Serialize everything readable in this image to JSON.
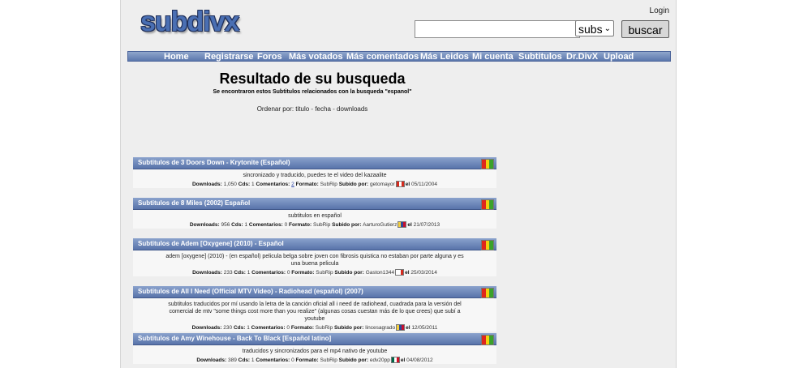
{
  "header": {
    "logo": "subdivx",
    "login": "Login",
    "search": {
      "value": "",
      "placeholder": ""
    },
    "select": {
      "selected": "subs"
    },
    "search_button": "buscar"
  },
  "nav": [
    "Home",
    "Registrarse",
    "Foros",
    "Más votados",
    "Más comentados",
    "Más Leidos",
    "Mi cuenta",
    "Subtitulos",
    "Dr.DivX",
    "Upload"
  ],
  "content": {
    "title": "Resultado de su busqueda",
    "subtitle": "Se encontraron estos Subtitulos relacionados con la busqueda \"espanol\"",
    "order_label": "Ordenar por:",
    "order_titulo": "titulo",
    "order_fecha": "fecha",
    "order_downloads": "downloads",
    "order_sep": "-"
  },
  "meta_labels": {
    "downloads": "Downloads:",
    "cds": "Cds:",
    "comentarios": "Comentarios:",
    "formato": "Formato:",
    "subido_por": "Subido por:",
    "el": "el"
  },
  "results": [
    {
      "title": "Subtitulos de 3 Doors Down - Krytonite (Español)",
      "description": "sincronizado y traducido, puedes te el video del kazaalite",
      "downloads": "1,050",
      "cds": "1",
      "comentarios": "2",
      "formato": "SubRip",
      "user": "getomayor",
      "date": "05/11/2004",
      "flag": [
        "#d52b1e",
        "#ffffff",
        "#d52b1e"
      ]
    },
    {
      "title": "Subtitulos de 8 Miles (2002) Español",
      "description": "subtitulos en español",
      "downloads": "956",
      "cds": "1",
      "comentarios": "0",
      "formato": "SubRip",
      "user": "AarturoGutierz",
      "date": "21/07/2013",
      "flag": [
        "#f4d03f",
        "#2c4a9a",
        "#c8102e"
      ]
    },
    {
      "title": "Subtitulos de Adem [Oxygene] (2010) - Español",
      "description": "adem [oxygene] (2010) - (en español) pelicula belga sobre joven con fibrosis quistica no estaban por parte alguna y es una buena pelicula",
      "downloads": "233",
      "cds": "1",
      "comentarios": "0",
      "formato": "SubRip",
      "user": "Gaston1344",
      "date": "25/03/2014",
      "flag": [
        "#ffffff",
        "#ffffff",
        "#d52b1e"
      ]
    },
    {
      "title": "Subtitulos de All I Need (Official MTV Video) - Radiohead (español) (2007)",
      "description": "subtitulos traducidos por mí usando la letra de la canción oficial all i need de radiohead, cuadrada para la versión del comercial de mtv \"some things cost more than you realize\" (algunas cosas cuestan más de lo que crees) que subí a youtube",
      "downloads": "230",
      "cds": "1",
      "comentarios": "0",
      "formato": "SubRip",
      "user": "lincesagrado",
      "date": "12/05/2011",
      "flag": [
        "#f4d03f",
        "#2c4a9a",
        "#c8102e"
      ]
    },
    {
      "title": "Subtitulos de Amy Winehouse - Back To Black [Español latino]",
      "description": "traducidos y sincronizados para el mp4 nativo de youtube",
      "downloads": "389",
      "cds": "1",
      "comentarios": "0",
      "formato": "SubRip",
      "user": "edv20pp",
      "date": "04/08/2012",
      "flag": [
        "#006847",
        "#ffffff",
        "#ce1126"
      ]
    }
  ],
  "colors": {
    "nav_bar": "#6a84b8",
    "result_header": "#6c85b8",
    "rating": [
      "#e0261b",
      "#f2d10f",
      "#3aa22a"
    ]
  }
}
